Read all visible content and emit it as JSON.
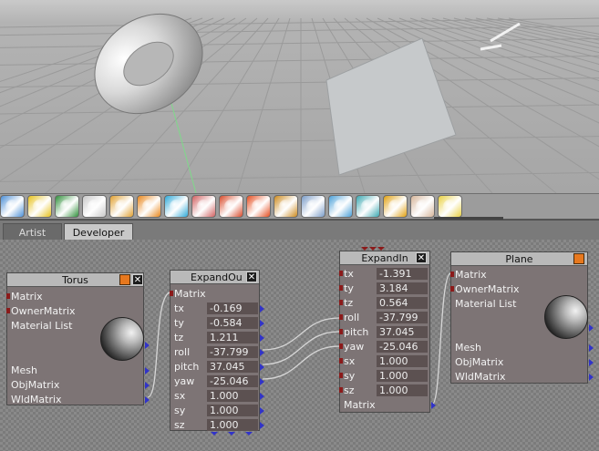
{
  "toolbar": {
    "icons": [
      "speaker-icon",
      "stage-icon",
      "plant-icon",
      "sphere-icon",
      "slime-icon",
      "blocks-icon",
      "paint-icon",
      "heart-icon",
      "brush-icon",
      "pizza-icon",
      "tools-icon",
      "checker-plane-icon",
      "checker-ball-icon",
      "molecule-icon",
      "mm-logo-icon",
      "face-icon",
      "sticker-icon"
    ],
    "icon_colors": [
      "#4c8fd6",
      "#e6c11a",
      "#2f8f3a",
      "#c8c8c8",
      "#e0a030",
      "#e8861a",
      "#2fa9d8",
      "#d06060",
      "#d84a2a",
      "#e54d1f",
      "#cc8a1e",
      "#7a9cc8",
      "#4aa0d8",
      "#3aa7b0",
      "#e0a010",
      "#d6b59a",
      "#e8d040"
    ]
  },
  "tabs": {
    "artist": "Artist",
    "developer": "Developer"
  },
  "nodes": {
    "torus": {
      "title": "Torus",
      "close": "✕",
      "inputs": [
        "Matrix",
        "OwnerMatrix",
        "Material List"
      ],
      "outputs": [
        "Mesh",
        "ObjMatrix",
        "WldMatrix"
      ]
    },
    "expand_out": {
      "title": "ExpandOu",
      "close": "✕",
      "input": "Matrix",
      "fields": [
        {
          "label": "tx",
          "value": "-0.169"
        },
        {
          "label": "ty",
          "value": "-0.584"
        },
        {
          "label": "tz",
          "value": "1.211"
        },
        {
          "label": "roll",
          "value": "-37.799"
        },
        {
          "label": "pitch",
          "value": "37.045"
        },
        {
          "label": "yaw",
          "value": "-25.046"
        },
        {
          "label": "sx",
          "value": "1.000"
        },
        {
          "label": "sy",
          "value": "1.000"
        },
        {
          "label": "sz",
          "value": "1.000"
        }
      ]
    },
    "expand_in": {
      "title": "ExpandIn",
      "close": "✕",
      "fields": [
        {
          "label": "tx",
          "value": "-1.391"
        },
        {
          "label": "ty",
          "value": "3.184"
        },
        {
          "label": "tz",
          "value": "0.564"
        },
        {
          "label": "roll",
          "value": "-37.799"
        },
        {
          "label": "pitch",
          "value": "37.045"
        },
        {
          "label": "yaw",
          "value": "-25.046"
        },
        {
          "label": "sx",
          "value": "1.000"
        },
        {
          "label": "sy",
          "value": "1.000"
        },
        {
          "label": "sz",
          "value": "1.000"
        }
      ],
      "output": "Matrix"
    },
    "plane": {
      "title": "Plane",
      "inputs": [
        "Matrix",
        "OwnerMatrix",
        "Material List"
      ],
      "outputs": [
        "Mesh",
        "ObjMatrix",
        "WldMatrix"
      ]
    }
  }
}
